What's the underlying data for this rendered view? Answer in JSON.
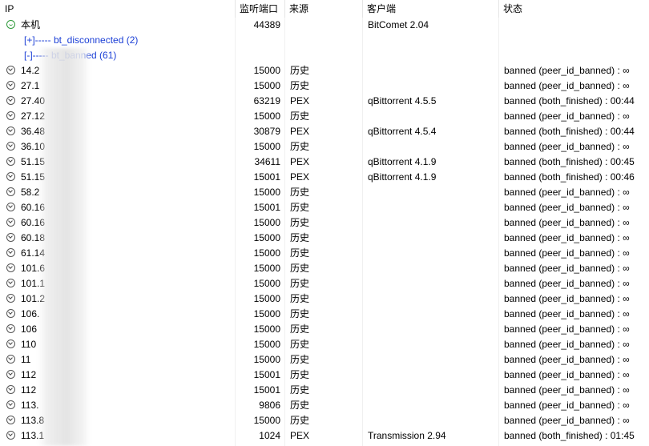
{
  "columns": {
    "ip": "IP",
    "port": "监听端口",
    "source": "来源",
    "client": "客户端",
    "status": "状态"
  },
  "local": {
    "ip": "本机",
    "port": "44389",
    "source": "",
    "client": "BitComet 2.04",
    "status": ""
  },
  "groups": {
    "disconnected": "[+]----- bt_disconnected (2)",
    "banned": "[-]----- bt_banned (61)"
  },
  "rows": [
    {
      "ip": "14.2",
      "port": "15000",
      "source": "历史",
      "client": "",
      "status": "banned (peer_id_banned) : ∞"
    },
    {
      "ip": "27.1",
      "port": "15000",
      "source": "历史",
      "client": "",
      "status": "banned (peer_id_banned) : ∞"
    },
    {
      "ip": "27.40",
      "port": "63219",
      "source": "PEX",
      "client": "qBittorrent 4.5.5",
      "status": "banned (both_finished) : 00:44"
    },
    {
      "ip": "27.12",
      "port": "15000",
      "source": "历史",
      "client": "",
      "status": "banned (peer_id_banned) : ∞"
    },
    {
      "ip": "36.48",
      "port": "30879",
      "source": "PEX",
      "client": "qBittorrent 4.5.4",
      "status": "banned (both_finished) : 00:44"
    },
    {
      "ip": "36.10",
      "port": "15000",
      "source": "历史",
      "client": "",
      "status": "banned (peer_id_banned) : ∞"
    },
    {
      "ip": "51.15",
      "port": "34611",
      "source": "PEX",
      "client": "qBittorrent 4.1.9",
      "status": "banned (both_finished) : 00:45"
    },
    {
      "ip": "51.15",
      "port": "15001",
      "source": "PEX",
      "client": "qBittorrent 4.1.9",
      "status": "banned (both_finished) : 00:46"
    },
    {
      "ip": "58.2",
      "port": "15000",
      "source": "历史",
      "client": "",
      "status": "banned (peer_id_banned) : ∞"
    },
    {
      "ip": "60.16",
      "port": "15001",
      "source": "历史",
      "client": "",
      "status": "banned (peer_id_banned) : ∞"
    },
    {
      "ip": "60.16",
      "port": "15000",
      "source": "历史",
      "client": "",
      "status": "banned (peer_id_banned) : ∞"
    },
    {
      "ip": "60.18",
      "port": "15000",
      "source": "历史",
      "client": "",
      "status": "banned (peer_id_banned) : ∞"
    },
    {
      "ip": "61.14",
      "port": "15000",
      "source": "历史",
      "client": "",
      "status": "banned (peer_id_banned) : ∞"
    },
    {
      "ip": "101.6",
      "port": "15000",
      "source": "历史",
      "client": "",
      "status": "banned (peer_id_banned) : ∞"
    },
    {
      "ip": "101.1",
      "port": "15000",
      "source": "历史",
      "client": "",
      "status": "banned (peer_id_banned) : ∞"
    },
    {
      "ip": "101.2",
      "port": "15000",
      "source": "历史",
      "client": "",
      "status": "banned (peer_id_banned) : ∞"
    },
    {
      "ip": "106.",
      "port": "15000",
      "source": "历史",
      "client": "",
      "status": "banned (peer_id_banned) : ∞"
    },
    {
      "ip": "106",
      "port": "15000",
      "source": "历史",
      "client": "",
      "status": "banned (peer_id_banned) : ∞"
    },
    {
      "ip": "110",
      "port": "15000",
      "source": "历史",
      "client": "",
      "status": "banned (peer_id_banned) : ∞"
    },
    {
      "ip": "11",
      "port": "15000",
      "source": "历史",
      "client": "",
      "status": "banned (peer_id_banned) : ∞"
    },
    {
      "ip": "112",
      "port": "15001",
      "source": "历史",
      "client": "",
      "status": "banned (peer_id_banned) : ∞"
    },
    {
      "ip": "112",
      "port": "15001",
      "source": "历史",
      "client": "",
      "status": "banned (peer_id_banned) : ∞"
    },
    {
      "ip": "113.",
      "port": "9806",
      "source": "历史",
      "client": "",
      "status": "banned (peer_id_banned) : ∞"
    },
    {
      "ip": "113.8",
      "port": "15000",
      "source": "历史",
      "client": "",
      "status": "banned (peer_id_banned) : ∞"
    },
    {
      "ip": "113.1",
      "port": "1024",
      "source": "PEX",
      "client": "Transmission 2.94",
      "status": "banned (both_finished) : 01:45"
    }
  ]
}
